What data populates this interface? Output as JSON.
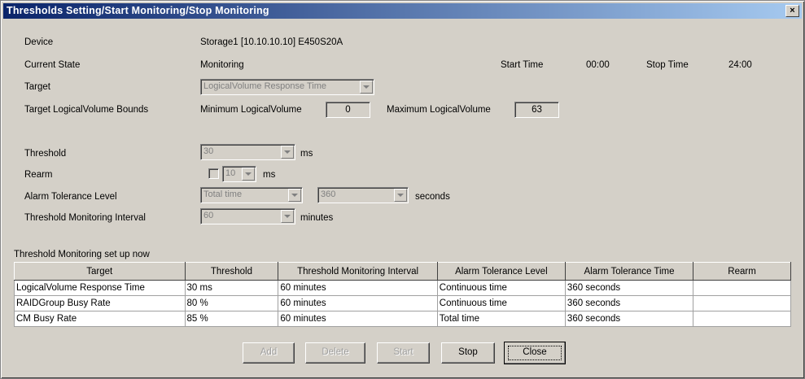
{
  "window": {
    "title": "Thresholds Setting/Start Monitoring/Stop Monitoring",
    "close_glyph": "×"
  },
  "fields": {
    "device_label": "Device",
    "device_value": "Storage1 [10.10.10.10] E450S20A",
    "current_state_label": "Current State",
    "current_state_value": "Monitoring",
    "start_time_label": "Start Time",
    "start_time_value": "00:00",
    "stop_time_label": "Stop Time",
    "stop_time_value": "24:00",
    "target_label": "Target",
    "target_value": "LogicalVolume Response Time",
    "bounds_label": "Target LogicalVolume Bounds",
    "min_label": "Minimum LogicalVolume",
    "min_value": "0",
    "max_label": "Maximum LogicalVolume",
    "max_value": "63",
    "threshold_label": "Threshold",
    "threshold_value": "30",
    "threshold_unit": "ms",
    "rearm_label": "Rearm",
    "rearm_value": "10",
    "rearm_unit": "ms",
    "alarm_label": "Alarm Tolerance Level",
    "alarm_type_value": "Total time",
    "alarm_seconds_value": "360",
    "alarm_unit": "seconds",
    "interval_label": "Threshold Monitoring Interval",
    "interval_value": "60",
    "interval_unit": "minutes"
  },
  "table": {
    "caption": "Threshold Monitoring set up now",
    "headers": [
      "Target",
      "Threshold",
      "Threshold Monitoring Interval",
      "Alarm Tolerance Level",
      "Alarm Tolerance Time",
      "Rearm"
    ],
    "rows": [
      [
        "LogicalVolume Response Time",
        "30 ms",
        "60 minutes",
        "Continuous time",
        "360 seconds",
        ""
      ],
      [
        "RAIDGroup Busy Rate",
        "80 %",
        "60 minutes",
        "Continuous time",
        "360 seconds",
        ""
      ],
      [
        "CM Busy Rate",
        "85 %",
        "60 minutes",
        "Total time",
        "360 seconds",
        ""
      ]
    ]
  },
  "buttons": {
    "add": "Add",
    "delete": "Delete",
    "start": "Start",
    "stop": "Stop",
    "close": "Close"
  }
}
